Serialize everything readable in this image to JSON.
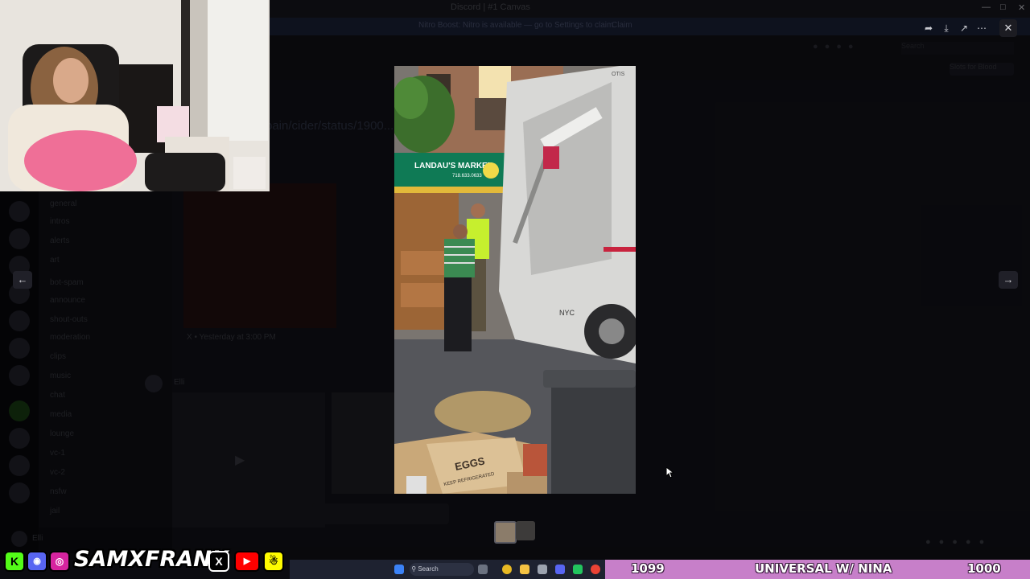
{
  "app": {
    "title": "Discord | #1 Canvas",
    "banner_text": "Nitro Boost: Nitro is available — go to Settings to claim",
    "banner_button": "Claim",
    "header_pill": "Slots for Blood",
    "search_placeholder": "Search"
  },
  "chat": {
    "link_fragment": "pain/cider/status/1900...",
    "posted_text": "X • Yesterday at 3:00 PM",
    "message_author": "Elli",
    "channels": [
      "general",
      "intros",
      "alerts",
      "art",
      "bot-spam",
      "announce",
      "shout-outs",
      "moderation",
      "clips",
      "music",
      "chat",
      "media",
      "lounge",
      "vc-1",
      "vc-2",
      "nsfw",
      "jail",
      "off-topic"
    ]
  },
  "viewer": {
    "controls": [
      "forward-icon",
      "download-icon",
      "open-external-icon",
      "more-icon"
    ],
    "close_label": "✕",
    "prev_label": "←",
    "next_label": "→",
    "media": {
      "sign_text": "LANDAU'S MARKET",
      "sign_phone": "718.633.0633",
      "box_text": "EGGS",
      "box_sub": "KEEP REFRIGERATED",
      "truck_text": "NYC",
      "truck_top": "OTIS"
    }
  },
  "stream": {
    "brand": "SAMXFRANK",
    "ticker_left_number": "1099",
    "ticker_title": "UNIVERSAL W/ NINA",
    "ticker_right_number": "1000",
    "social_icons": [
      "kick-icon",
      "discord-icon",
      "instagram-icon",
      "x-icon",
      "youtube-icon",
      "snapchat-icon"
    ],
    "colors": {
      "ticker_bg": "#c77fc9",
      "kick": "#53fc18",
      "youtube": "#ff0000",
      "snapchat": "#fffc00"
    }
  },
  "taskbar": {
    "search_label": "Search"
  }
}
